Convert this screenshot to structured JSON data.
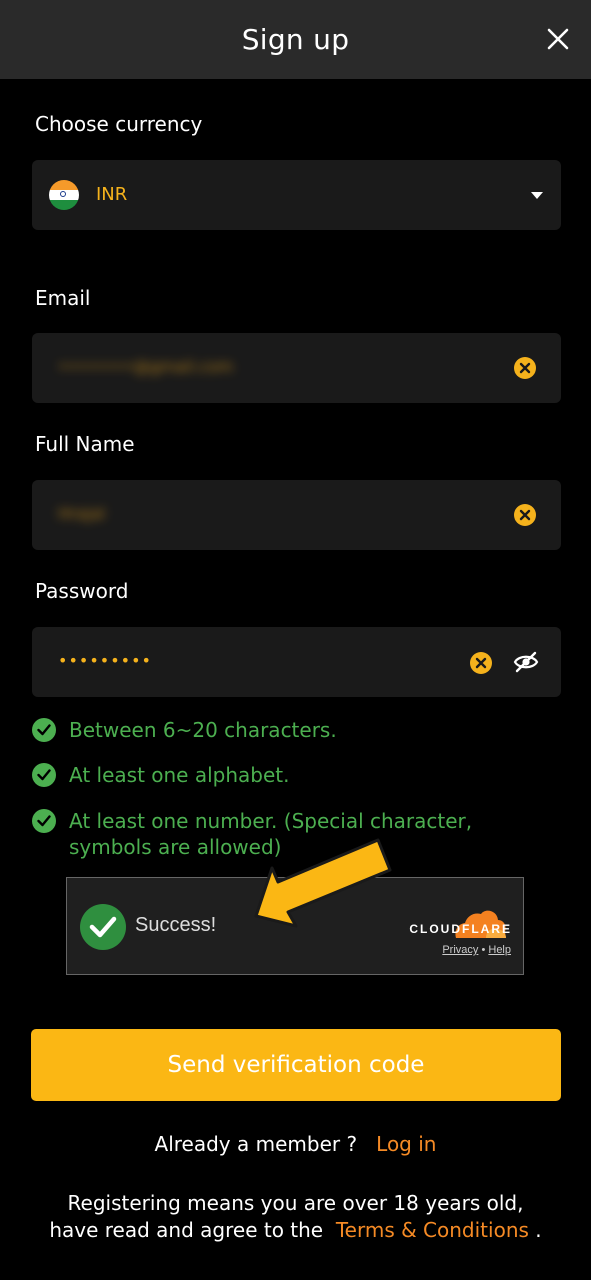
{
  "header": {
    "title": "Sign up"
  },
  "currency": {
    "label": "Choose currency",
    "value": "INR"
  },
  "email": {
    "label": "Email",
    "value": "••••••••@gmail.com"
  },
  "full_name": {
    "label": "Full Name",
    "value": "Hrajal"
  },
  "password": {
    "label": "Password",
    "value": "•••••••••"
  },
  "rules": [
    "Between 6~20 characters.",
    "At least one alphabet.",
    "At least one number. (Special character, symbols are allowed)"
  ],
  "captcha": {
    "status": "Success!",
    "brand": "CLOUDFLARE",
    "privacy": "Privacy",
    "separator": "•",
    "help": "Help"
  },
  "send_button": "Send verification code",
  "login": {
    "prompt": "Already a member ?",
    "link": "Log in"
  },
  "footer": {
    "text": "Registering means you are over 18 years old, have read and agree to the",
    "link": "Terms & Conditions",
    "end": "."
  },
  "colors": {
    "accent": "#fbb714",
    "link": "#f58a25",
    "success": "#4caf50",
    "field_bg": "#1a1a1a",
    "header_bg": "#2a2a2a"
  }
}
